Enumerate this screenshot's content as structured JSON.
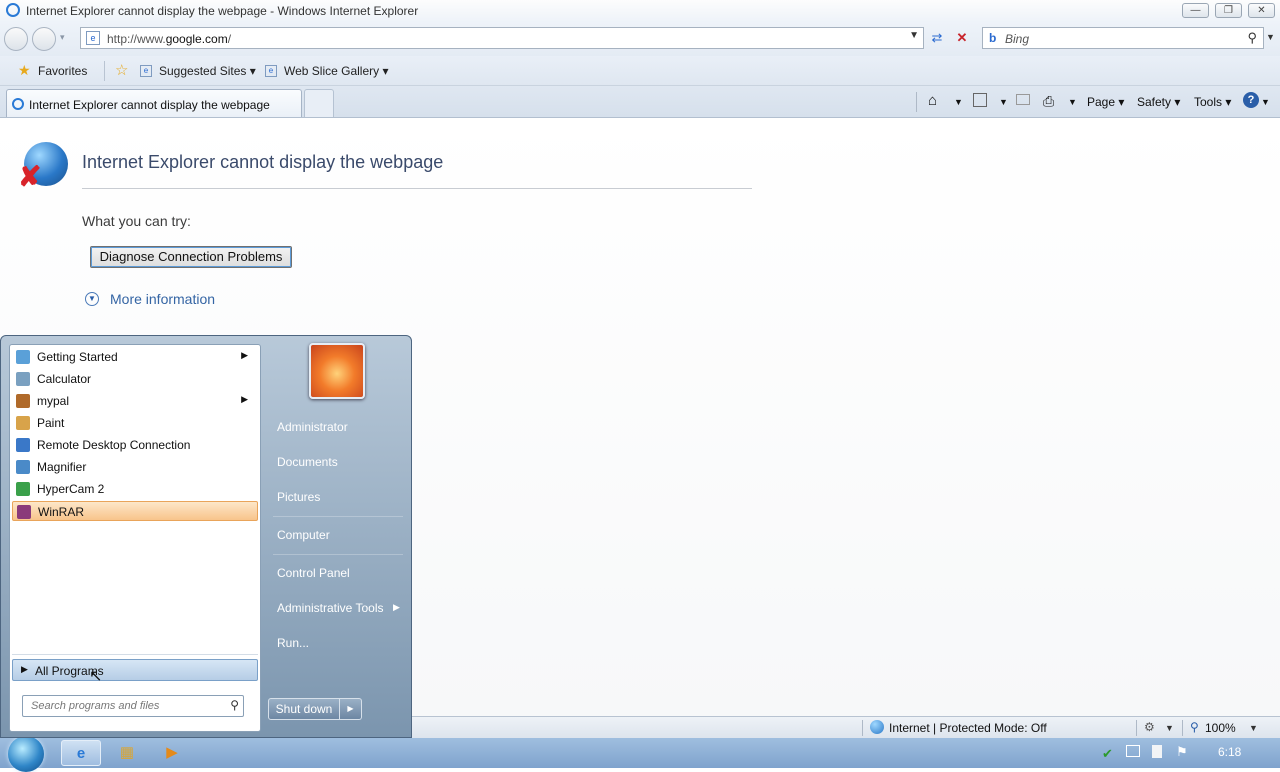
{
  "window": {
    "title": "Internet Explorer cannot display the webpage - Windows Internet Explorer"
  },
  "address": {
    "url_prefix": "http://www.",
    "url_domain": "google.com",
    "url_suffix": "/"
  },
  "search": {
    "placeholder": "Bing"
  },
  "favorites_bar": {
    "favorites_label": "Favorites",
    "suggested_sites_label": "Suggested Sites",
    "web_slice_label": "Web Slice Gallery"
  },
  "tabs": {
    "active_label": "Internet Explorer cannot display the webpage"
  },
  "command_bar": {
    "page_label": "Page",
    "safety_label": "Safety",
    "tools_label": "Tools"
  },
  "error_page": {
    "title": "Internet Explorer cannot display the webpage",
    "try_label": "What you can try:",
    "diagnose_button": "Diagnose Connection Problems",
    "more_info": "More information"
  },
  "status_bar": {
    "zone": "Internet | Protected Mode: Off",
    "zoom": "100%"
  },
  "start_menu": {
    "programs": [
      {
        "label": "Getting Started",
        "icon": "getting-started-icon",
        "submenu": true
      },
      {
        "label": "Calculator",
        "icon": "calculator-icon",
        "submenu": false
      },
      {
        "label": "mypal",
        "icon": "mypal-icon",
        "submenu": true
      },
      {
        "label": "Paint",
        "icon": "paint-icon",
        "submenu": false
      },
      {
        "label": "Remote Desktop Connection",
        "icon": "remote-desktop-icon",
        "submenu": false
      },
      {
        "label": "Magnifier",
        "icon": "magnifier-icon",
        "submenu": false
      },
      {
        "label": "HyperCam 2",
        "icon": "hypercam-icon",
        "submenu": false
      },
      {
        "label": "WinRAR",
        "icon": "winrar-icon",
        "submenu": false,
        "selected": true
      }
    ],
    "all_programs": "All Programs",
    "search_placeholder": "Search programs and files",
    "right_links": {
      "administrator": "Administrator",
      "documents": "Documents",
      "pictures": "Pictures",
      "computer": "Computer",
      "control_panel": "Control Panel",
      "admin_tools": "Administrative Tools",
      "run": "Run..."
    },
    "shutdown": "Shut down"
  },
  "taskbar": {
    "clock": "6:18"
  },
  "colors": {
    "link_blue": "#3465a4",
    "selection_orange": "#f8c48b",
    "taskbar_blue": "#7fa3cd"
  }
}
